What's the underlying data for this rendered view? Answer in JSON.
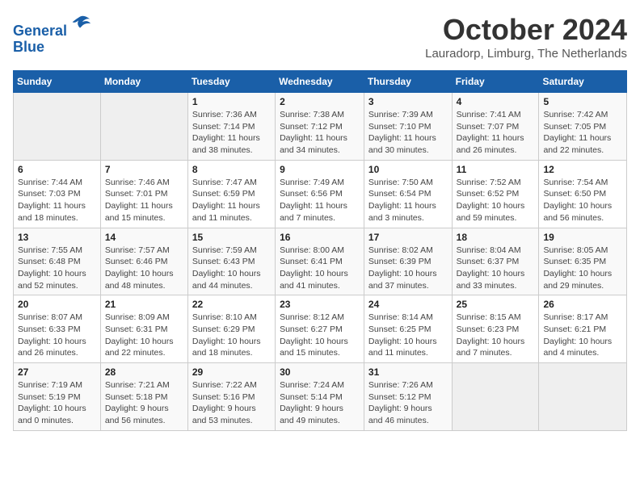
{
  "header": {
    "logo_line1": "General",
    "logo_line2": "Blue",
    "month_title": "October 2024",
    "location": "Lauradorp, Limburg, The Netherlands"
  },
  "days_of_week": [
    "Sunday",
    "Monday",
    "Tuesday",
    "Wednesday",
    "Thursday",
    "Friday",
    "Saturday"
  ],
  "weeks": [
    [
      {
        "day": "",
        "empty": true
      },
      {
        "day": "",
        "empty": true
      },
      {
        "day": "1",
        "sunrise": "Sunrise: 7:36 AM",
        "sunset": "Sunset: 7:14 PM",
        "daylight": "Daylight: 11 hours and 38 minutes."
      },
      {
        "day": "2",
        "sunrise": "Sunrise: 7:38 AM",
        "sunset": "Sunset: 7:12 PM",
        "daylight": "Daylight: 11 hours and 34 minutes."
      },
      {
        "day": "3",
        "sunrise": "Sunrise: 7:39 AM",
        "sunset": "Sunset: 7:10 PM",
        "daylight": "Daylight: 11 hours and 30 minutes."
      },
      {
        "day": "4",
        "sunrise": "Sunrise: 7:41 AM",
        "sunset": "Sunset: 7:07 PM",
        "daylight": "Daylight: 11 hours and 26 minutes."
      },
      {
        "day": "5",
        "sunrise": "Sunrise: 7:42 AM",
        "sunset": "Sunset: 7:05 PM",
        "daylight": "Daylight: 11 hours and 22 minutes."
      }
    ],
    [
      {
        "day": "6",
        "sunrise": "Sunrise: 7:44 AM",
        "sunset": "Sunset: 7:03 PM",
        "daylight": "Daylight: 11 hours and 18 minutes."
      },
      {
        "day": "7",
        "sunrise": "Sunrise: 7:46 AM",
        "sunset": "Sunset: 7:01 PM",
        "daylight": "Daylight: 11 hours and 15 minutes."
      },
      {
        "day": "8",
        "sunrise": "Sunrise: 7:47 AM",
        "sunset": "Sunset: 6:59 PM",
        "daylight": "Daylight: 11 hours and 11 minutes."
      },
      {
        "day": "9",
        "sunrise": "Sunrise: 7:49 AM",
        "sunset": "Sunset: 6:56 PM",
        "daylight": "Daylight: 11 hours and 7 minutes."
      },
      {
        "day": "10",
        "sunrise": "Sunrise: 7:50 AM",
        "sunset": "Sunset: 6:54 PM",
        "daylight": "Daylight: 11 hours and 3 minutes."
      },
      {
        "day": "11",
        "sunrise": "Sunrise: 7:52 AM",
        "sunset": "Sunset: 6:52 PM",
        "daylight": "Daylight: 10 hours and 59 minutes."
      },
      {
        "day": "12",
        "sunrise": "Sunrise: 7:54 AM",
        "sunset": "Sunset: 6:50 PM",
        "daylight": "Daylight: 10 hours and 56 minutes."
      }
    ],
    [
      {
        "day": "13",
        "sunrise": "Sunrise: 7:55 AM",
        "sunset": "Sunset: 6:48 PM",
        "daylight": "Daylight: 10 hours and 52 minutes."
      },
      {
        "day": "14",
        "sunrise": "Sunrise: 7:57 AM",
        "sunset": "Sunset: 6:46 PM",
        "daylight": "Daylight: 10 hours and 48 minutes."
      },
      {
        "day": "15",
        "sunrise": "Sunrise: 7:59 AM",
        "sunset": "Sunset: 6:43 PM",
        "daylight": "Daylight: 10 hours and 44 minutes."
      },
      {
        "day": "16",
        "sunrise": "Sunrise: 8:00 AM",
        "sunset": "Sunset: 6:41 PM",
        "daylight": "Daylight: 10 hours and 41 minutes."
      },
      {
        "day": "17",
        "sunrise": "Sunrise: 8:02 AM",
        "sunset": "Sunset: 6:39 PM",
        "daylight": "Daylight: 10 hours and 37 minutes."
      },
      {
        "day": "18",
        "sunrise": "Sunrise: 8:04 AM",
        "sunset": "Sunset: 6:37 PM",
        "daylight": "Daylight: 10 hours and 33 minutes."
      },
      {
        "day": "19",
        "sunrise": "Sunrise: 8:05 AM",
        "sunset": "Sunset: 6:35 PM",
        "daylight": "Daylight: 10 hours and 29 minutes."
      }
    ],
    [
      {
        "day": "20",
        "sunrise": "Sunrise: 8:07 AM",
        "sunset": "Sunset: 6:33 PM",
        "daylight": "Daylight: 10 hours and 26 minutes."
      },
      {
        "day": "21",
        "sunrise": "Sunrise: 8:09 AM",
        "sunset": "Sunset: 6:31 PM",
        "daylight": "Daylight: 10 hours and 22 minutes."
      },
      {
        "day": "22",
        "sunrise": "Sunrise: 8:10 AM",
        "sunset": "Sunset: 6:29 PM",
        "daylight": "Daylight: 10 hours and 18 minutes."
      },
      {
        "day": "23",
        "sunrise": "Sunrise: 8:12 AM",
        "sunset": "Sunset: 6:27 PM",
        "daylight": "Daylight: 10 hours and 15 minutes."
      },
      {
        "day": "24",
        "sunrise": "Sunrise: 8:14 AM",
        "sunset": "Sunset: 6:25 PM",
        "daylight": "Daylight: 10 hours and 11 minutes."
      },
      {
        "day": "25",
        "sunrise": "Sunrise: 8:15 AM",
        "sunset": "Sunset: 6:23 PM",
        "daylight": "Daylight: 10 hours and 7 minutes."
      },
      {
        "day": "26",
        "sunrise": "Sunrise: 8:17 AM",
        "sunset": "Sunset: 6:21 PM",
        "daylight": "Daylight: 10 hours and 4 minutes."
      }
    ],
    [
      {
        "day": "27",
        "sunrise": "Sunrise: 7:19 AM",
        "sunset": "Sunset: 5:19 PM",
        "daylight": "Daylight: 10 hours and 0 minutes."
      },
      {
        "day": "28",
        "sunrise": "Sunrise: 7:21 AM",
        "sunset": "Sunset: 5:18 PM",
        "daylight": "Daylight: 9 hours and 56 minutes."
      },
      {
        "day": "29",
        "sunrise": "Sunrise: 7:22 AM",
        "sunset": "Sunset: 5:16 PM",
        "daylight": "Daylight: 9 hours and 53 minutes."
      },
      {
        "day": "30",
        "sunrise": "Sunrise: 7:24 AM",
        "sunset": "Sunset: 5:14 PM",
        "daylight": "Daylight: 9 hours and 49 minutes."
      },
      {
        "day": "31",
        "sunrise": "Sunrise: 7:26 AM",
        "sunset": "Sunset: 5:12 PM",
        "daylight": "Daylight: 9 hours and 46 minutes."
      },
      {
        "day": "",
        "empty": true
      },
      {
        "day": "",
        "empty": true
      }
    ]
  ]
}
